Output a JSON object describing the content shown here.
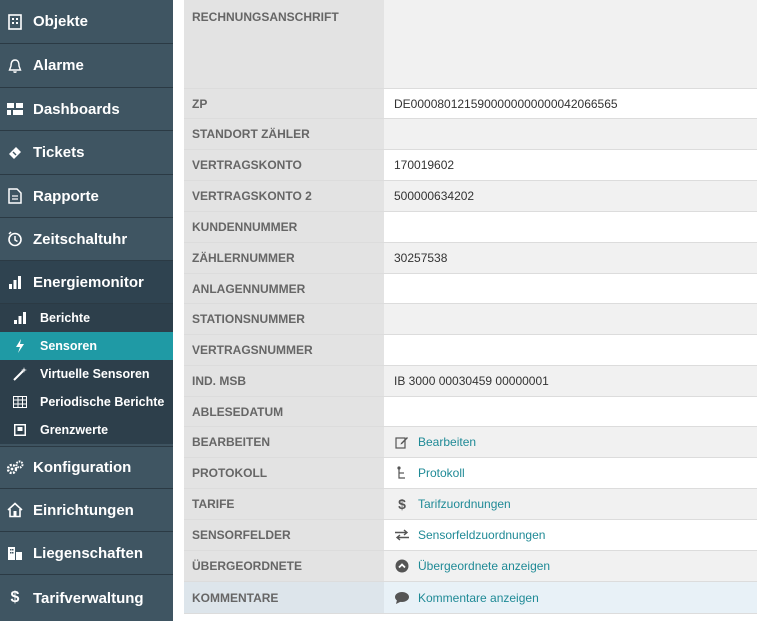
{
  "nav": {
    "objekte": "Objekte",
    "alarme": "Alarme",
    "dashboards": "Dashboards",
    "tickets": "Tickets",
    "rapporte": "Rapporte",
    "zeitschaltuhr": "Zeitschaltuhr",
    "energiemonitor": "Energiemonitor",
    "sub": {
      "berichte": "Berichte",
      "sensoren": "Sensoren",
      "virtuelle": "Virtuelle Sensoren",
      "periodische": "Periodische Berichte",
      "grenzwerte": "Grenzwerte"
    },
    "konfiguration": "Konfiguration",
    "einrichtungen": "Einrichtungen",
    "liegenschaften": "Liegenschaften",
    "tarifverwaltung": "Tarifverwaltung"
  },
  "rows": {
    "rechnungsanschrift": {
      "label": "RECHNUNGSANSCHRIFT",
      "value": ""
    },
    "zp": {
      "label": "ZP",
      "value": "DE0000801215900000000000042066565"
    },
    "standort": {
      "label": "STANDORT ZÄHLER",
      "value": ""
    },
    "vertragskonto": {
      "label": "VERTRAGSKONTO",
      "value": "170019602"
    },
    "vertragskonto2": {
      "label": "VERTRAGSKONTO 2",
      "value": "500000634202"
    },
    "kundennummer": {
      "label": "KUNDENNUMMER",
      "value": ""
    },
    "zaehlernummer": {
      "label": "ZÄHLERNUMMER",
      "value": "30257538"
    },
    "anlagennummer": {
      "label": "ANLAGENNUMMER",
      "value": ""
    },
    "stationsnummer": {
      "label": "STATIONSNUMMER",
      "value": ""
    },
    "vertragsnummer": {
      "label": "VERTRAGSNUMMER",
      "value": ""
    },
    "indmsb": {
      "label": "IND. MSB",
      "value": "IB 3000 00030459 00000001"
    },
    "ablesedatum": {
      "label": "ABLESEDATUM",
      "value": ""
    },
    "bearbeiten": {
      "label": "BEARBEITEN",
      "value": "Bearbeiten"
    },
    "protokoll": {
      "label": "PROTOKOLL",
      "value": "Protokoll"
    },
    "tarife": {
      "label": "TARIFE",
      "value": "Tarifzuordnungen"
    },
    "sensorfelder": {
      "label": "SENSORFELDER",
      "value": "Sensorfeldzuordnungen"
    },
    "uebergeordnete": {
      "label": "ÜBERGEORDNETE",
      "value": "Übergeordnete anzeigen"
    },
    "kommentare": {
      "label": "KOMMENTARE",
      "value": "Kommentare anzeigen"
    }
  }
}
